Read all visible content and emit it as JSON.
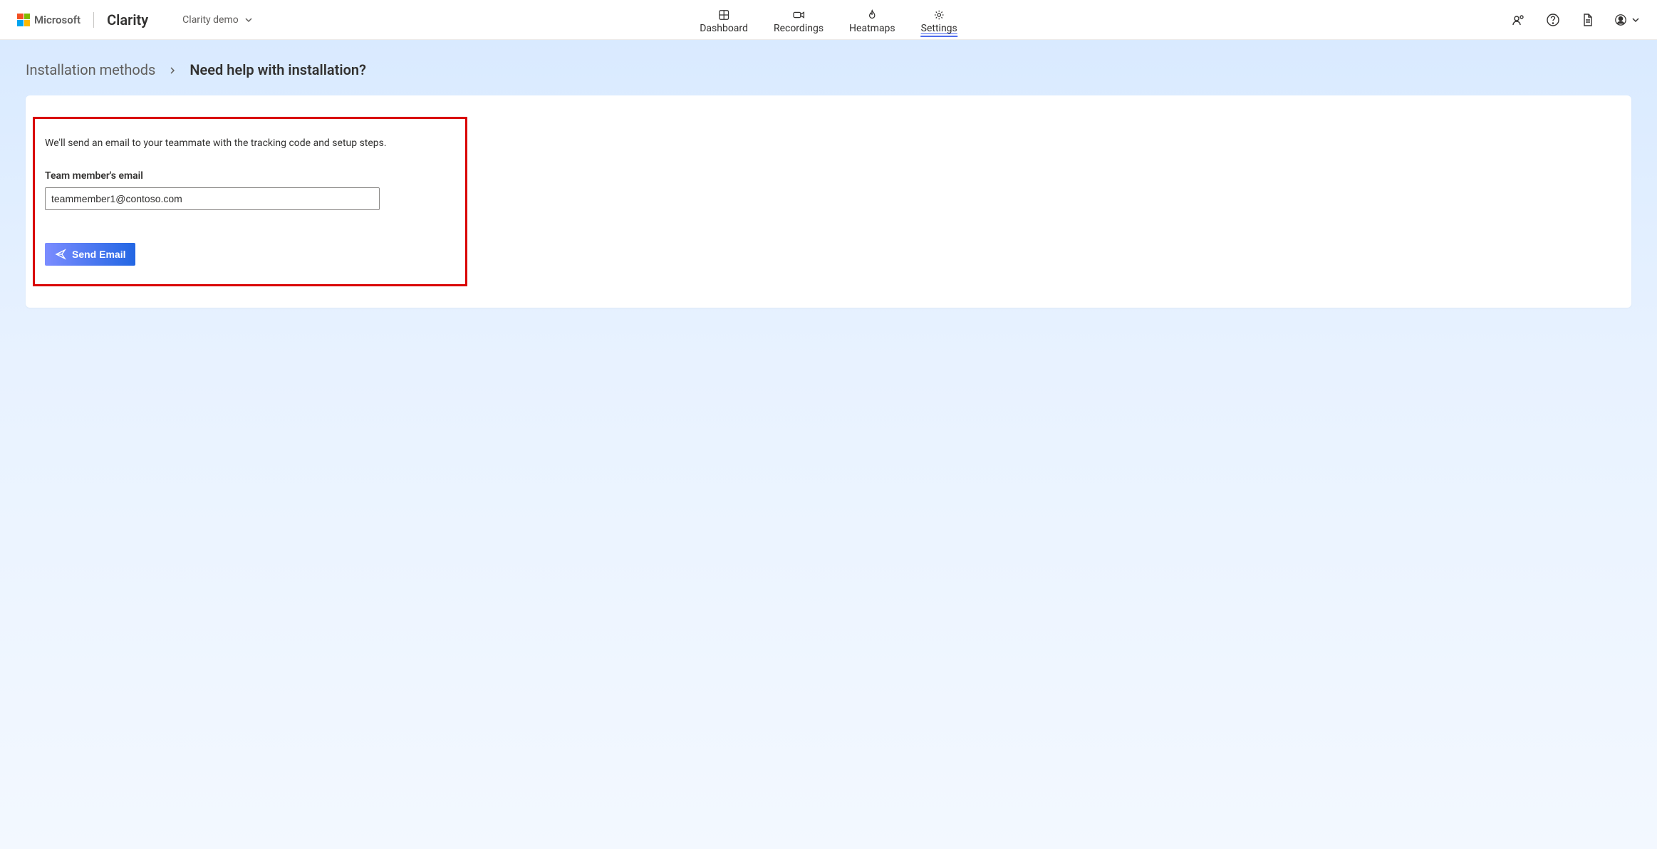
{
  "header": {
    "microsoft": "Microsoft",
    "brand": "Clarity",
    "project_name": "Clarity demo",
    "tabs": {
      "dashboard": "Dashboard",
      "recordings": "Recordings",
      "heatmaps": "Heatmaps",
      "settings": "Settings"
    }
  },
  "breadcrumb": {
    "prev": "Installation methods",
    "current": "Need help with installation?"
  },
  "form": {
    "intro": "We'll send an email to your teammate with the tracking code and setup steps.",
    "email_label": "Team member's email",
    "email_value": "teammember1@contoso.com",
    "send_label": "Send Email"
  }
}
